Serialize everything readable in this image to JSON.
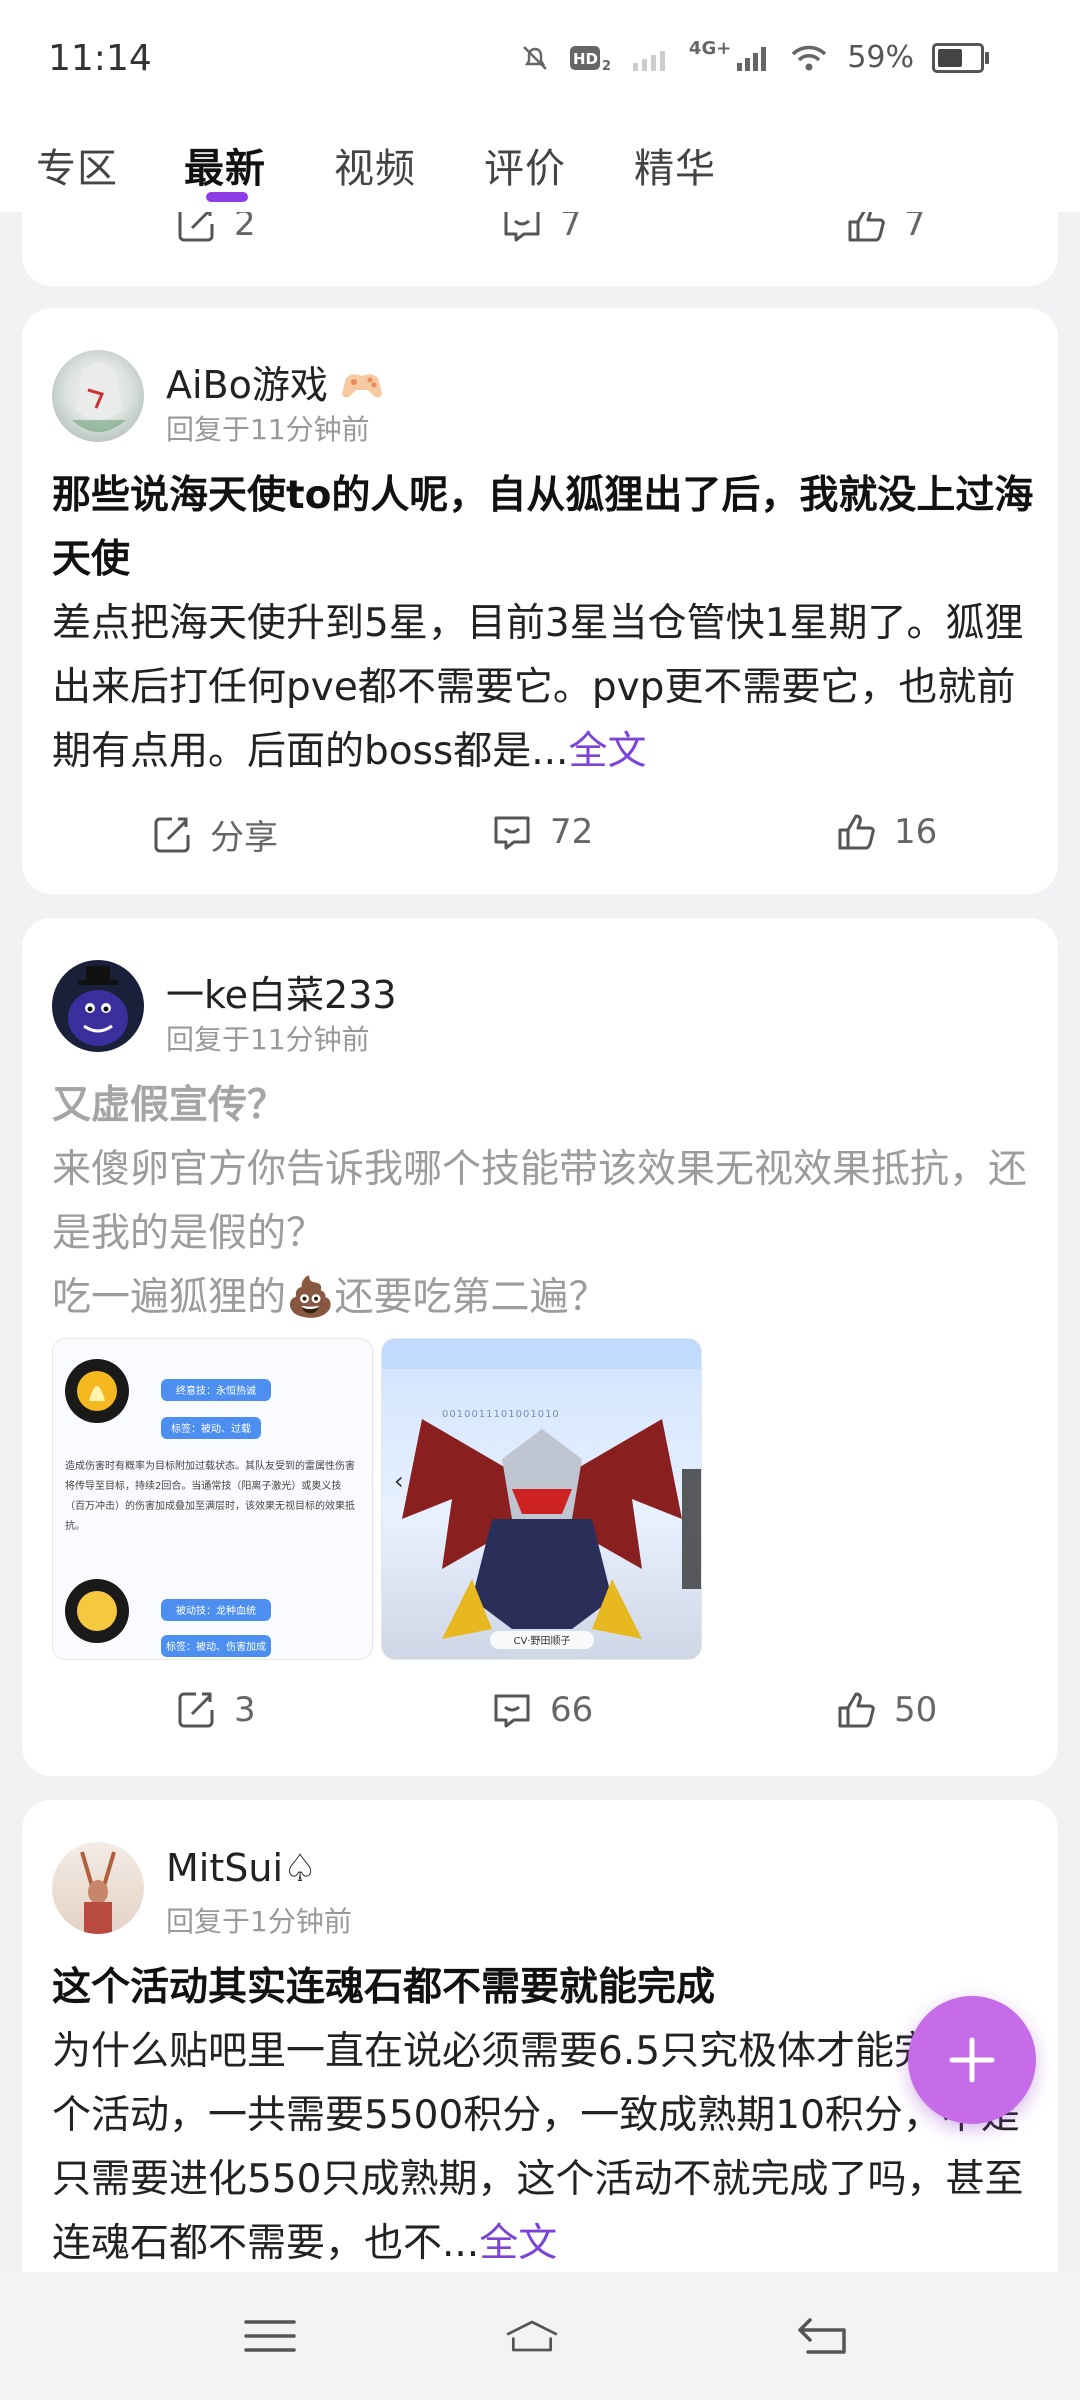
{
  "status": {
    "time": "11:14",
    "network": "4G+",
    "battery": "59%",
    "battery_level": 0.59
  },
  "tabs": [
    {
      "label": "专区",
      "active": false
    },
    {
      "label": "最新",
      "active": true
    },
    {
      "label": "视频",
      "active": false
    },
    {
      "label": "评价",
      "active": false
    },
    {
      "label": "精华",
      "active": false
    }
  ],
  "prev_card": {
    "share": "2",
    "comments": "7",
    "likes": "7"
  },
  "posts": [
    {
      "author": "AiBo游戏",
      "badge_icon": "game-controller-icon",
      "time": "回复于11分钟前",
      "title": "那些说海天使to的人呢，自从狐狸出了后，我就没上过海天使",
      "body": "差点把海天使升到5星，目前3星当仓管快1星期了。狐狸出来后打任何pve都不需要它。pvp更不需要它，也就前期有点用。后面的boss都是...",
      "read_more": "全文",
      "share": "分享",
      "comments": "72",
      "likes": "16"
    },
    {
      "author": "一ke白菜233",
      "time": "回复于11分钟前",
      "title": "又虚假宣传？",
      "body_lines": [
        "来傻卵官方你告诉我哪个技能带该效果无视效果抵抗，还是我的是假的？",
        "吃一遍狐狸的💩还要吃第二遍？"
      ],
      "image1": {
        "tag1": "终意技：永恒热诚",
        "tag2": "标签：被动、过载",
        "desc": "造成伤害时有概率为目标附加过载状态。其队友受到的雷属性伤害将传导至目标，持续2回合。当通常技（阳离子激光）或奥义技（百万冲击）的伤害加成叠加至满层时，该效果无视目标的效果抵抗。",
        "tag3": "被动技：龙种血统",
        "tag4": "标签：被动、伤害加成"
      },
      "image2": {
        "caption": "CV·野田顺子",
        "code": "0010011101001010"
      },
      "share": "3",
      "comments": "66",
      "likes": "50"
    },
    {
      "author": "MitSui♤",
      "time": "回复于1分钟前",
      "title": "这个活动其实连魂石都不需要就能完成",
      "body": "为什么贴吧里一直在说必须需要6.5只究极体才能完成这个活动，一共需要5500积分，一致成熟期10积分，不是只需要进化550只成熟期，这个活动不就完成了吗，甚至连魂石都不需要，也不...",
      "read_more": "全文"
    }
  ],
  "colors": {
    "accent": "#8d3ee6",
    "link": "#7c44d6",
    "fab": "#c76ce8"
  }
}
